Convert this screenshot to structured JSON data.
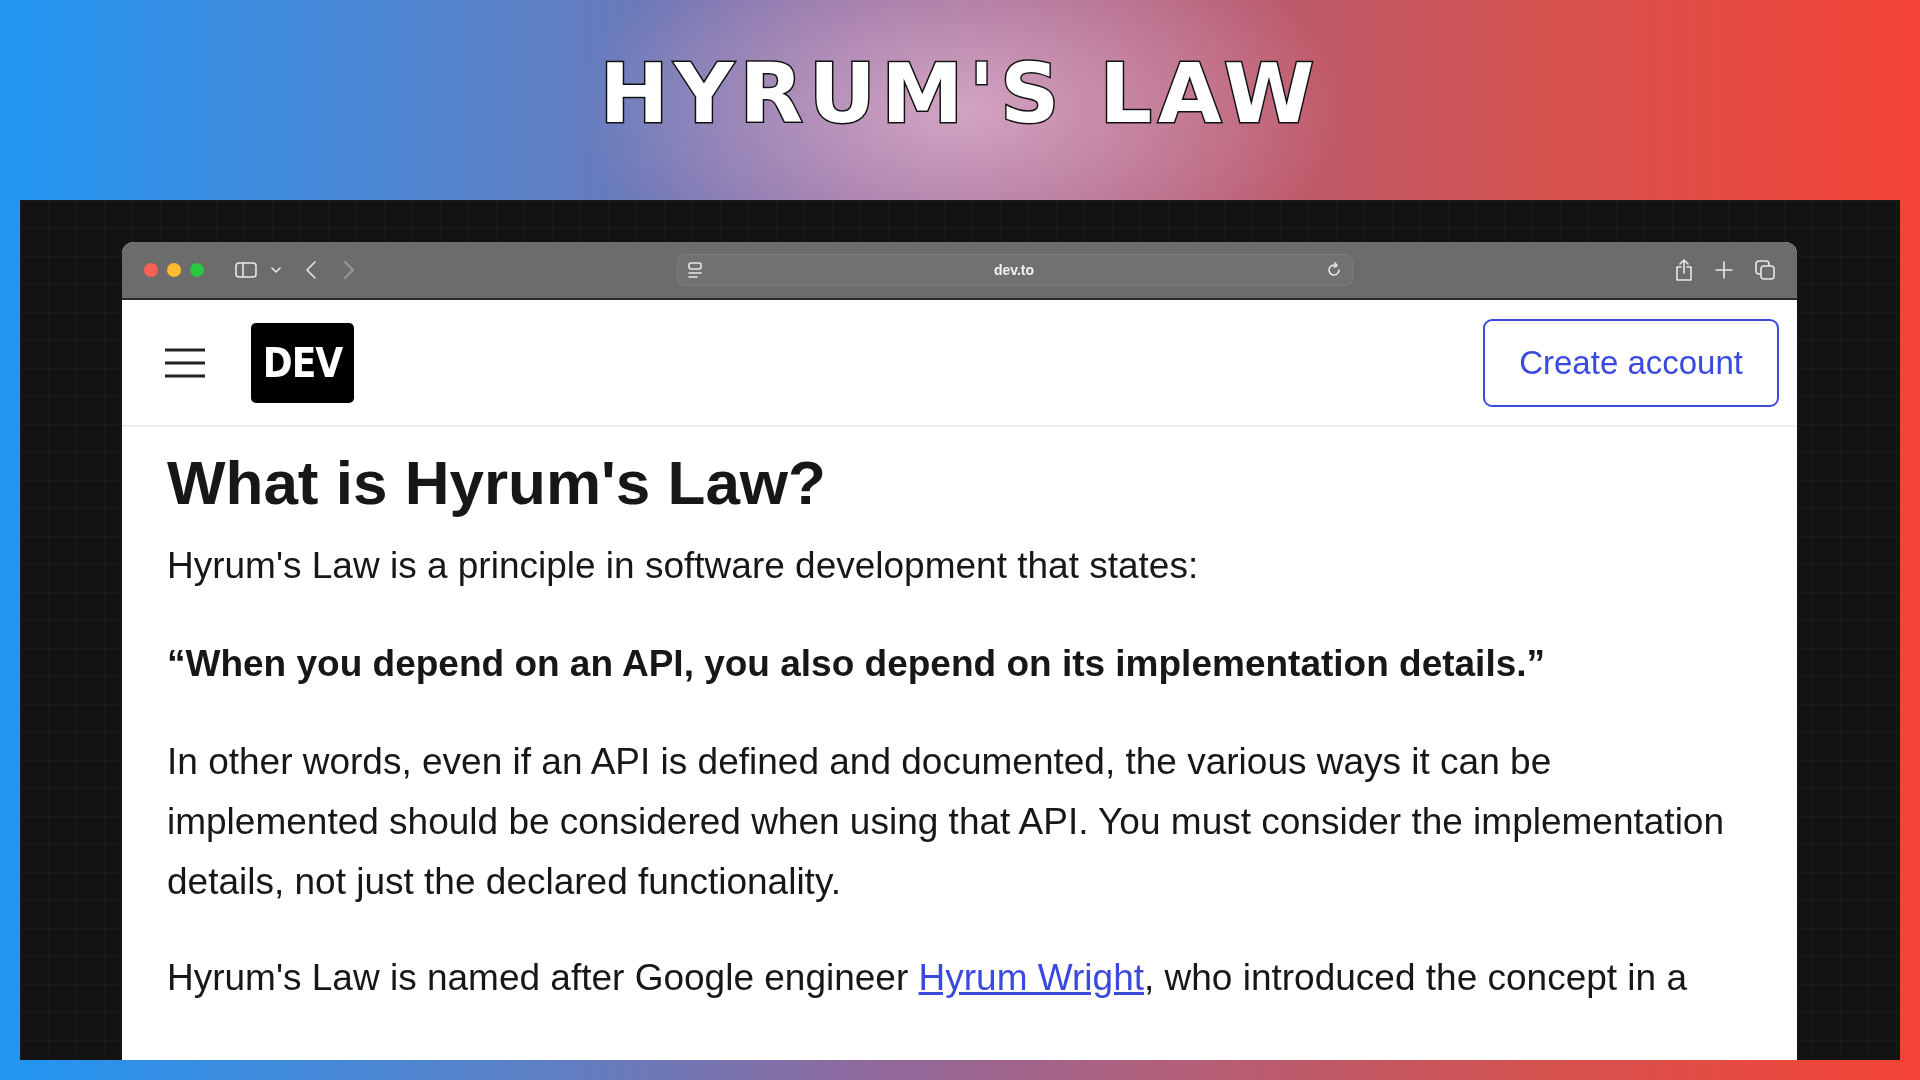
{
  "banner": {
    "title": "HYRUM'S LAW"
  },
  "browser": {
    "address": "dev.to"
  },
  "site_header": {
    "logo": "DEV",
    "button": "Create account"
  },
  "article": {
    "heading": "What is Hyrum's Law?",
    "paragraphs": [
      {
        "kind": "text",
        "text": "Hyrum's Law is a principle in software development that states:"
      },
      {
        "kind": "quote",
        "text": "“When you depend on an API, you also depend on its implementation details.”"
      },
      {
        "kind": "text",
        "text": "In other words, even if an API is defined and documented, the various ways it can be implemented should be considered when using that API. You must consider the implementation details, not just the declared functionality."
      },
      {
        "kind": "link_text",
        "before": "Hyrum's Law is named after Google engineer ",
        "link": "Hyrum Wright",
        "after": ", who introduced the concept in a"
      }
    ]
  }
}
